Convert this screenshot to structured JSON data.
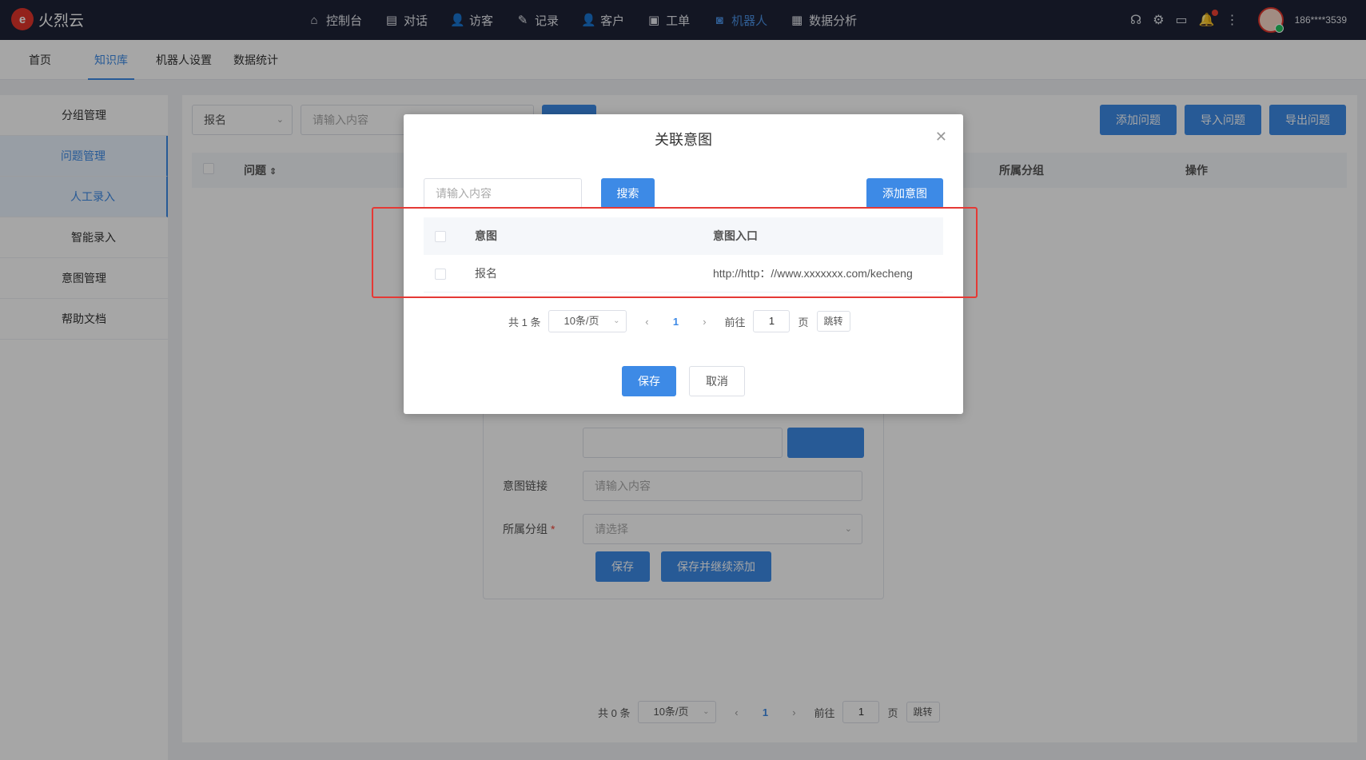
{
  "app": {
    "logo_text": "火烈云",
    "logo_mark": "e"
  },
  "main_nav": [
    {
      "label": "控制台",
      "icon": "home-icon",
      "glyph": "⌂"
    },
    {
      "label": "对话",
      "icon": "chat-icon",
      "glyph": "▤"
    },
    {
      "label": "访客",
      "icon": "visitor-icon",
      "glyph": "👤"
    },
    {
      "label": "记录",
      "icon": "record-icon",
      "glyph": "✎"
    },
    {
      "label": "客户",
      "icon": "customer-icon",
      "glyph": "👤"
    },
    {
      "label": "工单",
      "icon": "ticket-icon",
      "glyph": "▣"
    },
    {
      "label": "机器人",
      "icon": "robot-icon",
      "glyph": "◙"
    },
    {
      "label": "数据分析",
      "icon": "chart-icon",
      "glyph": "▦"
    }
  ],
  "active_nav": "机器人",
  "user": {
    "name": "186****3539"
  },
  "sub_nav": [
    {
      "label": "首页"
    },
    {
      "label": "知识库"
    },
    {
      "label": "机器人设置"
    },
    {
      "label": "数据统计"
    }
  ],
  "sidebar": [
    {
      "label": "分组管理"
    },
    {
      "label": "问题管理"
    },
    {
      "label": "人工录入"
    },
    {
      "label": "智能录入"
    },
    {
      "label": "意图管理"
    },
    {
      "label": "帮助文档"
    }
  ],
  "filter": {
    "select_value": "报名",
    "input_placeholder": "请输入内容"
  },
  "top_actions": {
    "add": "添加问题",
    "import": "导入问题",
    "export": "导出问题"
  },
  "list_head": {
    "question": "问题",
    "group": "所属分组",
    "action": "操作"
  },
  "form": {
    "link_label": "意图链接",
    "link_placeholder": "请输入内容",
    "group_label": "所属分组",
    "required_mark": "*",
    "group_placeholder": "请选择",
    "save": "保存",
    "save_continue": "保存并继续添加"
  },
  "main_pager": {
    "total": "共 0 条",
    "size": "10条/页",
    "current": "1",
    "goto": "前往",
    "page_value": "1",
    "page_unit": "页",
    "jump": "跳转"
  },
  "modal": {
    "title": "关联意图",
    "search_placeholder": "请输入内容",
    "search_btn": "搜索",
    "add_btn": "添加意图",
    "col_intent": "意图",
    "col_entry": "意图入口",
    "rows": [
      {
        "intent": "报名",
        "entry": "http://http：//www.xxxxxxx.com/kecheng"
      }
    ],
    "pager": {
      "total": "共 1 条",
      "size": "10条/页",
      "current": "1",
      "goto": "前往",
      "page_value": "1",
      "page_unit": "页",
      "jump": "跳转"
    },
    "save": "保存",
    "cancel": "取消"
  }
}
